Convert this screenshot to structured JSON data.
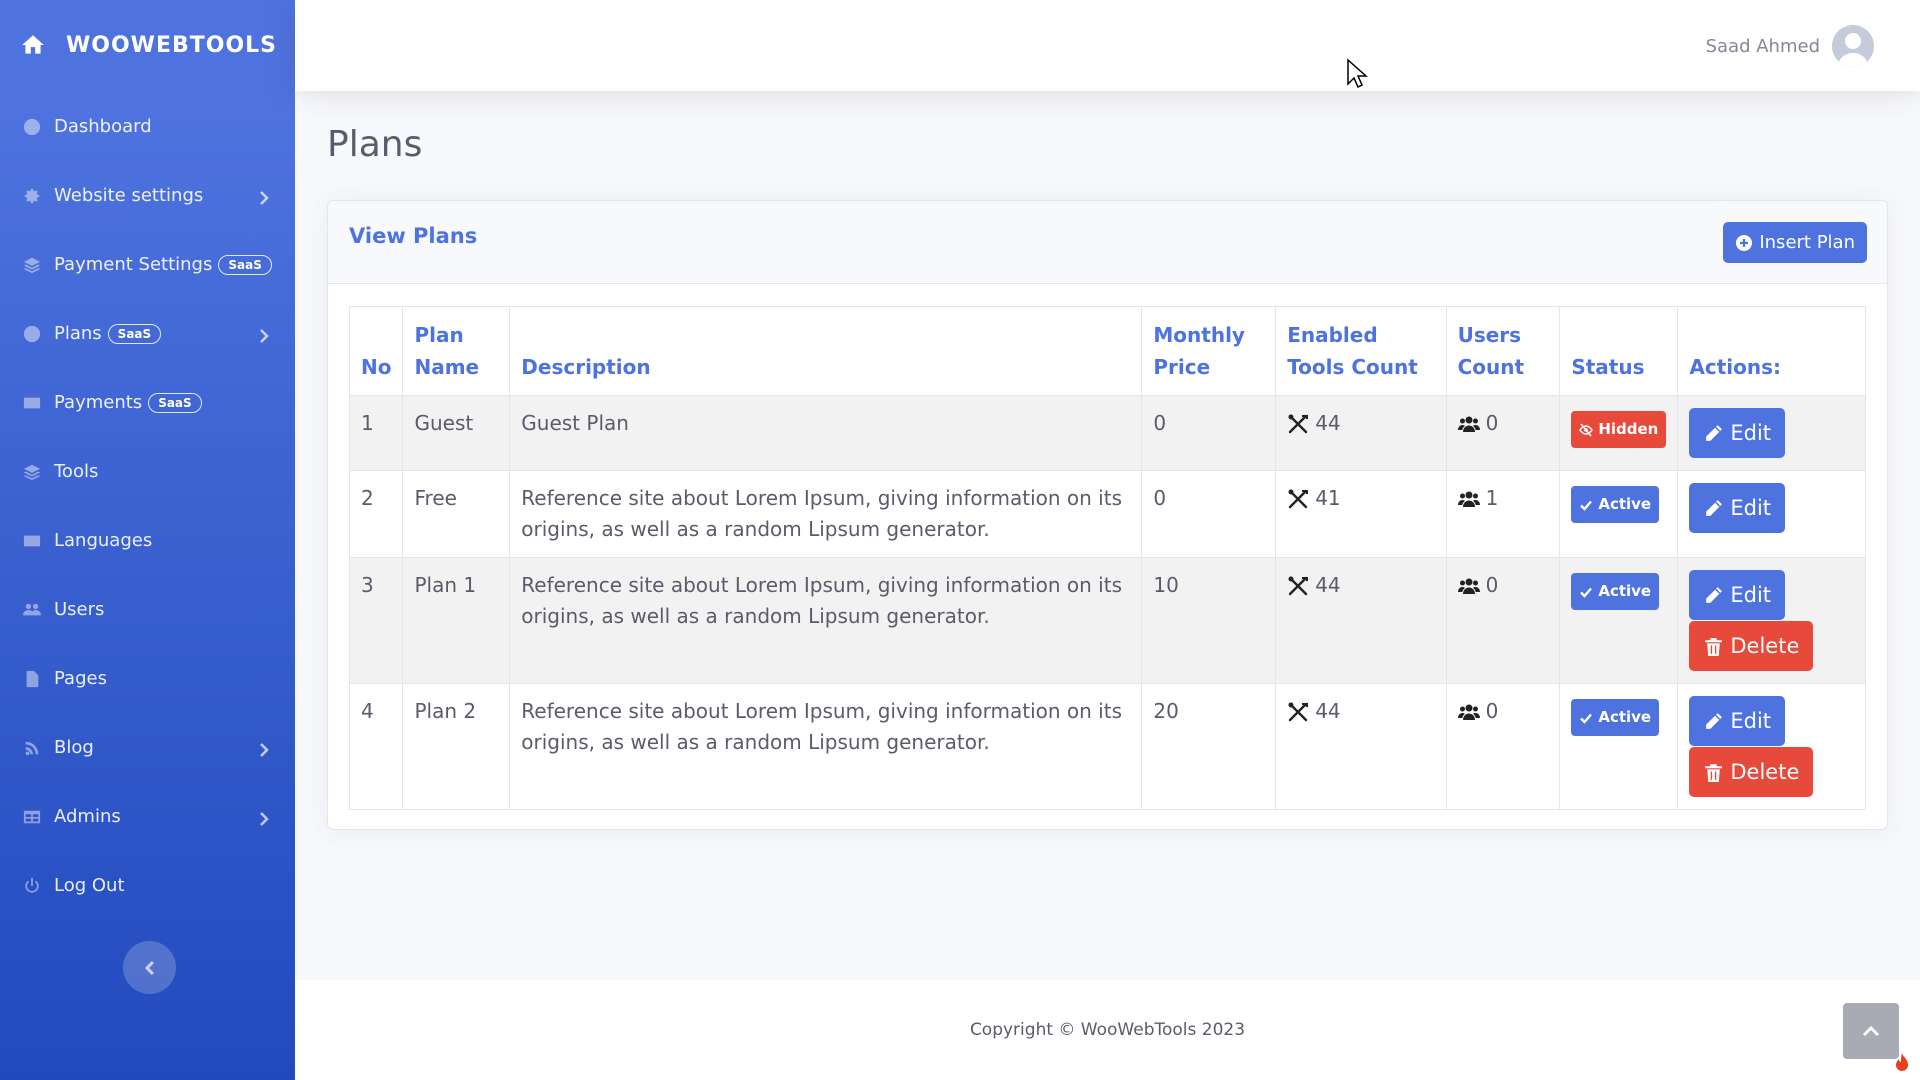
{
  "brand": {
    "name": "WOOWEBTOOLS"
  },
  "sidebar": {
    "items": [
      {
        "label": "Dashboard",
        "icon": "dashboard-icon",
        "badge": null,
        "has_submenu": false
      },
      {
        "label": "Website settings",
        "icon": "gear-icon",
        "badge": null,
        "has_submenu": true
      },
      {
        "label": "Payment Settings",
        "icon": "layers-icon",
        "badge": "SaaS",
        "has_submenu": false
      },
      {
        "label": "Plans",
        "icon": "dollar-icon",
        "badge": "SaaS",
        "has_submenu": true
      },
      {
        "label": "Payments",
        "icon": "money-icon",
        "badge": "SaaS",
        "has_submenu": false
      },
      {
        "label": "Tools",
        "icon": "layers-icon",
        "badge": null,
        "has_submenu": false
      },
      {
        "label": "Languages",
        "icon": "language-icon",
        "badge": null,
        "has_submenu": false
      },
      {
        "label": "Users",
        "icon": "users-icon",
        "badge": null,
        "has_submenu": false
      },
      {
        "label": "Pages",
        "icon": "file-icon",
        "badge": null,
        "has_submenu": false
      },
      {
        "label": "Blog",
        "icon": "blog-icon",
        "badge": null,
        "has_submenu": true
      },
      {
        "label": "Admins",
        "icon": "table-icon",
        "badge": null,
        "has_submenu": true
      },
      {
        "label": "Log Out",
        "icon": "power-icon",
        "badge": null,
        "has_submenu": false
      }
    ]
  },
  "topbar": {
    "user_name": "Saad Ahmed"
  },
  "page": {
    "title": "Plans"
  },
  "card": {
    "title": "View Plans",
    "insert_label": "Insert Plan"
  },
  "table": {
    "headers": {
      "no": "No",
      "name": "Plan Name",
      "description": "Description",
      "price": "Monthly Price",
      "tools": "Enabled Tools Count",
      "users": "Users Count",
      "status": "Status",
      "actions": "Actions:"
    },
    "rows": [
      {
        "no": "1",
        "name": "Guest",
        "description": "Guest Plan",
        "price": "0",
        "tools": "44",
        "users": "0",
        "status": "Hidden",
        "edit": "Edit",
        "delete": null
      },
      {
        "no": "2",
        "name": "Free",
        "description": "Reference site about Lorem Ipsum, giving information on its origins, as well as a random Lipsum generator.",
        "price": "0",
        "tools": "41",
        "users": "1",
        "status": "Active",
        "edit": "Edit",
        "delete": null
      },
      {
        "no": "3",
        "name": "Plan 1",
        "description": "Reference site about Lorem Ipsum, giving information on its origins, as well as a random Lipsum generator.",
        "price": "10",
        "tools": "44",
        "users": "0",
        "status": "Active",
        "edit": "Edit",
        "delete": "Delete"
      },
      {
        "no": "4",
        "name": "Plan 2",
        "description": "Reference site about Lorem Ipsum, giving information on its origins, as well as a random Lipsum generator.",
        "price": "20",
        "tools": "44",
        "users": "0",
        "status": "Active",
        "edit": "Edit",
        "delete": "Delete"
      }
    ]
  },
  "footer": {
    "copyright": "Copyright © WooWebTools 2023"
  },
  "colors": {
    "primary": "#4e73df",
    "danger": "#e74a3b",
    "sidebar_dark": "#224abe"
  }
}
